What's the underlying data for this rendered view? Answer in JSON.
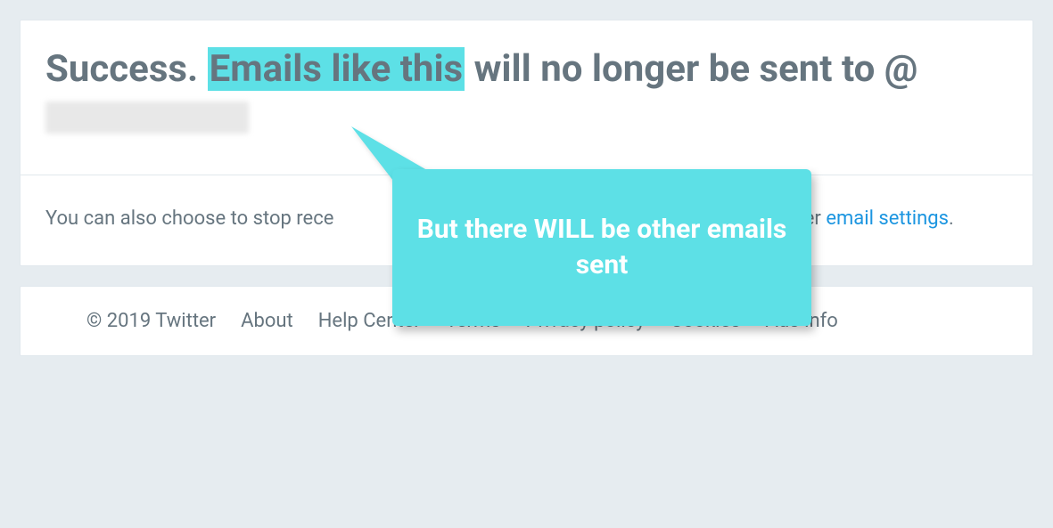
{
  "main": {
    "heading_prefix": "Success. ",
    "heading_highlight": "Emails like this",
    "heading_mid": " will no longer be sent to @",
    "subtext_prefix": "You can also choose to stop rece",
    "subtext_mid_hidden": "",
    "subtext_suffix_before_link": " other ",
    "link_text": "email settings",
    "subtext_period": "."
  },
  "callout": {
    "text": "But there WILL be other emails sent"
  },
  "footer": {
    "copyright": "© 2019 Twitter",
    "links": {
      "about": "About",
      "help": "Help Center",
      "terms": "Terms",
      "privacy": "Privacy policy",
      "cookies": "Cookies",
      "ads": "Ads info"
    }
  }
}
